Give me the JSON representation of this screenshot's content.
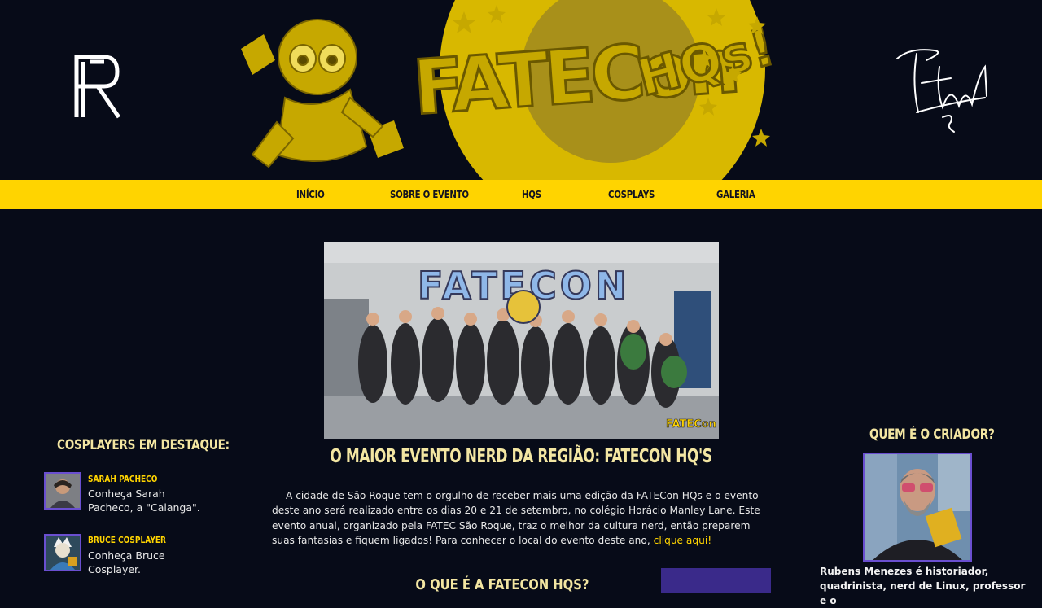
{
  "header": {
    "left_logo": "fr-monogram-logo",
    "right_logo": "signature-logo",
    "banner_title": "FATECON HQs!"
  },
  "nav": {
    "items": [
      {
        "label": "INÍCIO"
      },
      {
        "label": "SOBRE O EVENTO"
      },
      {
        "label": "HQS"
      },
      {
        "label": "COSPLAYS"
      },
      {
        "label": "GALERIA"
      }
    ]
  },
  "hero": {
    "wall_text": "FATECON",
    "badge": "FATECon HQs!"
  },
  "main": {
    "headline": "O MAIOR EVENTO NERD DA REGIÃO: FATECON HQ'S",
    "intro_text": "A cidade de São Roque tem o orgulho de receber mais uma edição da FATECon HQs e o evento deste ano será realizado entre os dias 20 e 21 de setembro, no colégio Horácio Manley Lane. Este evento anual, organizado pela FATEC São Roque, traz o melhor da cultura nerd, então preparem suas fantasias e fiquem ligados! Para conhecer o local do evento deste ano, ",
    "intro_link": "clique aqui!",
    "section2_title": "O QUE É A FATECON HQS?"
  },
  "left_sidebar": {
    "title": "COSPLAYERS EM DESTAQUE:",
    "cosplayers": [
      {
        "name": "SARAH PACHECO",
        "desc": "Conheça Sarah Pacheco, a \"Calanga\"."
      },
      {
        "name": "BRUCE COSPLAYER",
        "desc": "Conheça Bruce Cosplayer."
      }
    ]
  },
  "right_sidebar": {
    "title": "QUEM É O CRIADOR?",
    "bio": "Rubens Menezes é historiador, quadrinista, nerd de Linux, professor e o"
  },
  "colors": {
    "background": "#070b18",
    "accent_yellow": "#ffd400",
    "title_cream": "#f3e6a2",
    "frame_purple": "#6a4fd0"
  }
}
